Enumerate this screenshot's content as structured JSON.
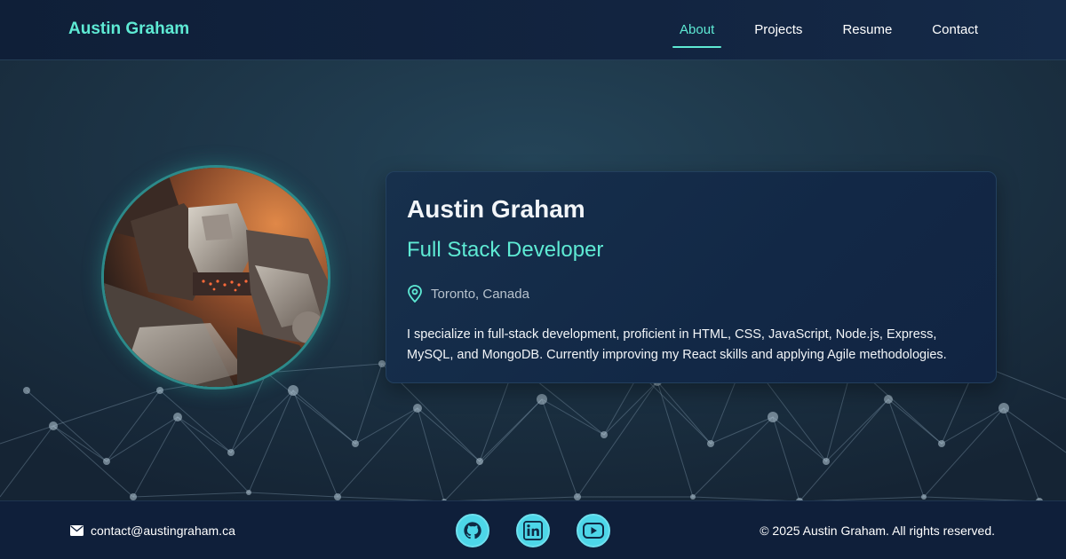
{
  "header": {
    "brand": "Austin Graham",
    "nav": [
      {
        "label": "About",
        "active": true
      },
      {
        "label": "Projects",
        "active": false
      },
      {
        "label": "Resume",
        "active": false
      },
      {
        "label": "Contact",
        "active": false
      }
    ]
  },
  "profile": {
    "name": "Austin Graham",
    "title": "Full Stack Developer",
    "location": "Toronto, Canada",
    "location_icon": "map-pin-icon",
    "bio": "I specialize in full-stack development, proficient in HTML, CSS, JavaScript, Node.js, Express, MySQL, and MongoDB. Currently improving my React skills and applying Agile methodologies.",
    "avatar": "robot-mech-portrait"
  },
  "footer": {
    "email": "contact@austingraham.ca",
    "email_icon": "envelope-icon",
    "socials": [
      {
        "name": "github-icon"
      },
      {
        "name": "linkedin-icon"
      },
      {
        "name": "youtube-icon"
      }
    ],
    "copyright": "© 2025 Austin Graham. All rights reserved."
  },
  "colors": {
    "accent": "#5eead4",
    "social": "#4dd6e8",
    "header_bg": "#0f1f38",
    "footer_bg": "#0f1f3a",
    "card_bg": "#122846"
  }
}
